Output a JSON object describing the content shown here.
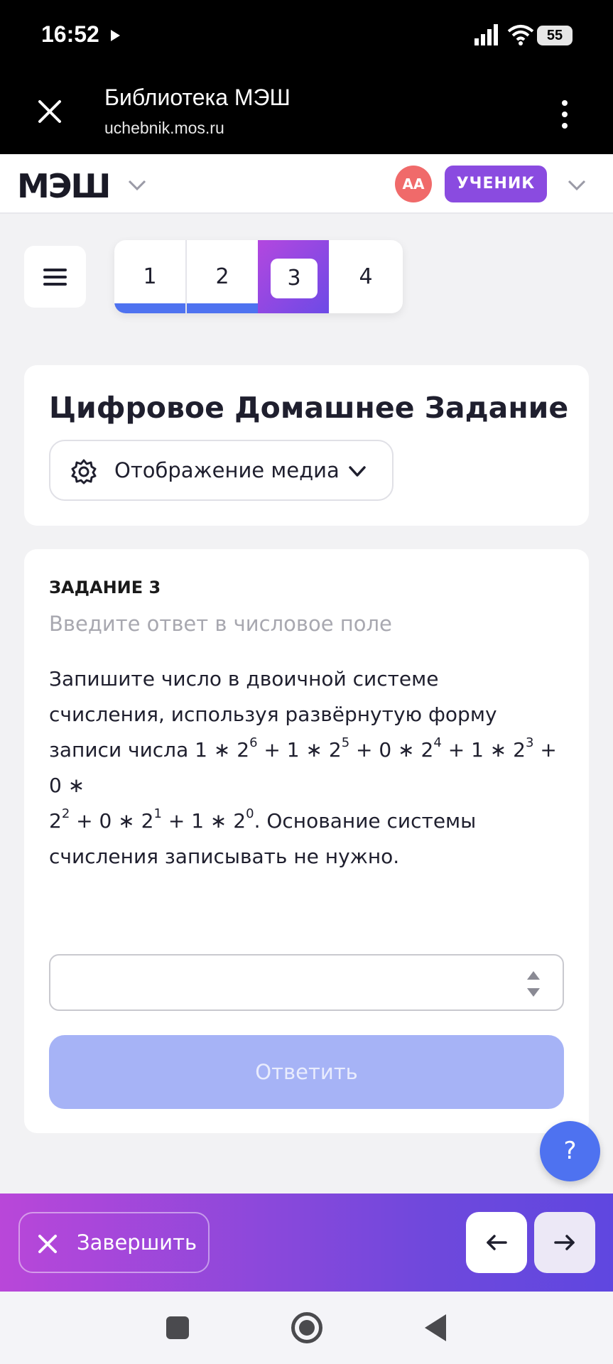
{
  "status_bar": {
    "time": "16:52",
    "battery": "55"
  },
  "browser": {
    "title": "Библиотека МЭШ",
    "url": "uchebnik.mos.ru"
  },
  "header": {
    "logo": "МЭШ",
    "avatar_initials": "АА",
    "role": "УЧЕНИК"
  },
  "tasks_nav": {
    "tabs": [
      {
        "label": "1",
        "state": "completed"
      },
      {
        "label": "2",
        "state": "completed"
      },
      {
        "label": "3",
        "state": "active"
      },
      {
        "label": "4",
        "state": "pending"
      }
    ]
  },
  "page": {
    "title": "Цифровое Домашнее Задание",
    "media_button": "Отображение медиа"
  },
  "task": {
    "heading": "ЗАДАНИЕ 3",
    "hint": "Введите ответ в числовое поле",
    "text_line1": "Запишите число в двоичной системе",
    "text_line2": "счисления, используя развёрнутую форму",
    "text_line3_prefix": "записи числа",
    "text_line5": "счисления записывать не нужно.",
    "formula": {
      "terms": [
        {
          "coef": "1",
          "base": "2",
          "exp": "6"
        },
        {
          "coef": "1",
          "base": "2",
          "exp": "5"
        },
        {
          "coef": "0",
          "base": "2",
          "exp": "4"
        },
        {
          "coef": "1",
          "base": "2",
          "exp": "3"
        },
        {
          "coef": "0",
          "base": "2",
          "exp": "2"
        },
        {
          "coef": "0",
          "base": "2",
          "exp": "1"
        },
        {
          "coef": "1",
          "base": "2",
          "exp": "0"
        }
      ],
      "suffix": ". Основание системы"
    },
    "answer_value": "",
    "submit_label": "Ответить"
  },
  "help_label": "?",
  "bottom": {
    "finish_label": "Завершить"
  },
  "colors": {
    "accent_blue": "#4e72f0",
    "accent_purple": "#8a4be0",
    "submit_disabled": "#a6b3f6"
  }
}
